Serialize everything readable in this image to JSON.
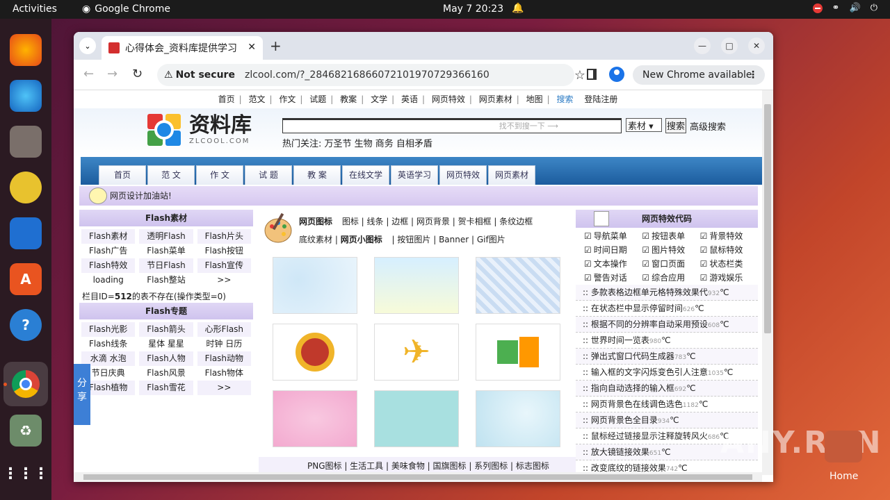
{
  "topbar": {
    "activities": "Activities",
    "app": "Google Chrome",
    "clock": "May 7  20:23"
  },
  "dock": [
    "firefox-icon",
    "thunderbird-icon",
    "files-icon",
    "rhythmbox-icon",
    "writer-icon",
    "appcenter-icon",
    "help-icon",
    "chrome-icon",
    "trash-icon",
    "apps-grid-icon"
  ],
  "browser": {
    "tab_title": "心得体会_资料库提供学习",
    "not_secure": "Not secure",
    "url": "zlcool.com/?_28468216866072101970729366160",
    "new_chrome": "New Chrome available"
  },
  "topnav": [
    "首页",
    "范文",
    "作文",
    "试题",
    "教案",
    "文学",
    "英语",
    "网页特效",
    "网页素材",
    "地图",
    "搜索",
    "登陆注册"
  ],
  "header": {
    "logo_text": "资料库",
    "logo_sub": "ZLCOOL.COM",
    "search_hint": "找不到搜一下 ⟶",
    "select_value": "素材",
    "search_btn": "搜索",
    "advanced": "高级搜索",
    "hot": "热门关注:  万圣节 生物 商务 自相矛盾"
  },
  "bluetabs": [
    "首页",
    "范 文",
    "作 文",
    "试 题",
    "教 案",
    "在线文学",
    "英语学习",
    "网页特效",
    "网页素材"
  ],
  "motto": "网页设计加油站!",
  "flash1": {
    "title": "Flash素材",
    "items": [
      "Flash素材",
      "透明Flash",
      "Flash片头",
      "Flash广告",
      "Flash菜单",
      "Flash按钮",
      "Flash特效",
      "节日Flash",
      "Flash宣传",
      "loading",
      "Flash整站",
      ">>"
    ]
  },
  "note": {
    "pre": "栏目ID=",
    "id": "512",
    "post": "的表不存在(操作类型=0)"
  },
  "flash2": {
    "title": "Flash专题",
    "items": [
      "Flash光影",
      "Flash箭头",
      "心形Flash",
      "Flash线条",
      "星体 星星",
      "时钟 日历",
      "水滴 水泡",
      "Flash人物",
      "Flash动物",
      "节日庆典",
      "Flash风景",
      "Flash物体",
      "Flash植物",
      "Flash雪花",
      ">>"
    ]
  },
  "share": "分享",
  "mid": {
    "title": "网页图标",
    "row1": [
      "图标",
      "线条",
      "边框",
      "网页背景",
      "贺卡相框",
      "条纹边框"
    ],
    "row2_lead": "底纹素材",
    "row2_bold": "网页小图标",
    "row2": [
      "按钮图片",
      "Banner",
      "Gif图片"
    ],
    "footer": "PNG图标 |  生活工具 |  美味食物 |  国旗图标 |  系列图标 |  标志图标"
  },
  "right": {
    "title": "网页特效代码",
    "checks": [
      "导航菜单",
      "按钮表单",
      "背景特效",
      "时间日期",
      "图片特效",
      "鼠标特效",
      "文本操作",
      "窗口页面",
      "状态栏类",
      "警告对话",
      "综合应用",
      "游戏娱乐"
    ],
    "list": [
      {
        "t": "多款表格边框单元格特殊效果代",
        "n": "932",
        "u": "℃"
      },
      {
        "t": "在状态栏中显示停留时间",
        "n": "626",
        "u": "℃"
      },
      {
        "t": "根据不同的分辨率自动采用预设",
        "n": "608",
        "u": "℃"
      },
      {
        "t": "世界时间一览表",
        "n": "980",
        "u": "℃"
      },
      {
        "t": "弹出式窗口代码生成器",
        "n": "783",
        "u": "℃"
      },
      {
        "t": "输入框的文字闪烁变色引人注意",
        "n": "1035",
        "u": "℃"
      },
      {
        "t": "指向自动选择的输入框",
        "n": "692",
        "u": "℃"
      },
      {
        "t": "网页背景色在线调色选色",
        "n": "1182",
        "u": "℃"
      },
      {
        "t": "网页背景色全目录",
        "n": "934",
        "u": "℃"
      },
      {
        "t": "鼠标经过链接显示注释旋转风火",
        "n": "686",
        "u": "℃"
      },
      {
        "t": "放大镜链接效果",
        "n": "651",
        "u": "℃"
      },
      {
        "t": "改变底纹的链接效果",
        "n": "742",
        "u": "℃"
      }
    ]
  },
  "watermark": "ANY.RUN",
  "home_label": "Home"
}
